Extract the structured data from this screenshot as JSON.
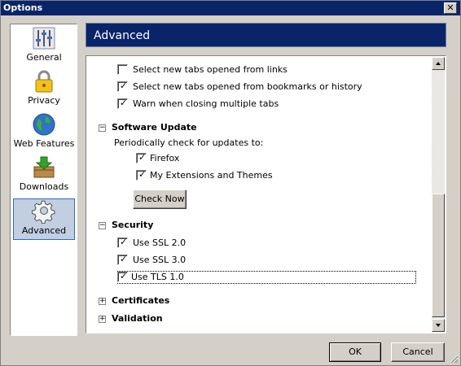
{
  "window": {
    "title": "Options",
    "close_glyph": "✕"
  },
  "sidebar": {
    "items": [
      {
        "label": "General",
        "icon": "general-sliders-icon"
      },
      {
        "label": "Privacy",
        "icon": "padlock-icon"
      },
      {
        "label": "Web Features",
        "icon": "globe-icon"
      },
      {
        "label": "Downloads",
        "icon": "downloads-box-icon"
      },
      {
        "label": "Advanced",
        "icon": "gear-icon",
        "selected": true
      }
    ]
  },
  "header": {
    "title": "Advanced"
  },
  "tabs_section": {
    "items": [
      {
        "label": "Select new tabs opened from links",
        "checked": false
      },
      {
        "label": "Select new tabs opened from bookmarks or history",
        "checked": true
      },
      {
        "label": "Warn when closing multiple tabs",
        "checked": true
      }
    ]
  },
  "software_update": {
    "title": "Software Update",
    "toggle": "−",
    "description": "Periodically check for updates to:",
    "items": [
      {
        "label": "Firefox",
        "checked": true
      },
      {
        "label": "My Extensions and Themes",
        "checked": true
      }
    ],
    "check_now_label": "Check Now"
  },
  "security": {
    "title": "Security",
    "toggle": "−",
    "items": [
      {
        "label": "Use SSL 2.0",
        "checked": true
      },
      {
        "label": "Use SSL 3.0",
        "checked": true
      },
      {
        "label": "Use TLS 1.0",
        "checked": true
      }
    ]
  },
  "certificates": {
    "title": "Certificates",
    "toggle": "+"
  },
  "validation": {
    "title": "Validation",
    "toggle": "+"
  },
  "buttons": {
    "ok": "OK",
    "cancel": "Cancel"
  },
  "check_glyph": "✓",
  "colors": {
    "header_bg": "#0a246a",
    "selected_item_bg": "#c1cfe0",
    "dialog_bg": "#d4d0c8"
  }
}
